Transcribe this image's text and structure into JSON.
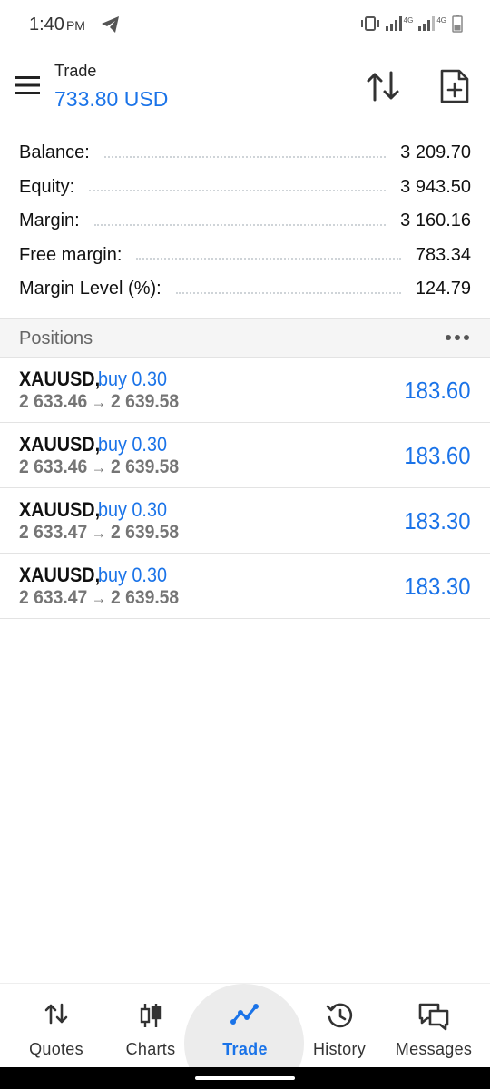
{
  "status_bar": {
    "time": "1:40",
    "ampm": "PM",
    "network_1": "4G",
    "network_2": "4G"
  },
  "header": {
    "title": "Trade",
    "value": "733.80 USD",
    "icons": [
      "menu-icon",
      "sort-icon",
      "new-order-icon"
    ]
  },
  "account": [
    {
      "label": "Balance:",
      "value": "3 209.70"
    },
    {
      "label": "Equity:",
      "value": "3 943.50"
    },
    {
      "label": "Margin:",
      "value": "3 160.16"
    },
    {
      "label": "Free margin:",
      "value": "783.34"
    },
    {
      "label": "Margin Level (%):",
      "value": "124.79"
    }
  ],
  "positions": {
    "title": "Positions",
    "items": [
      {
        "symbol": "XAUUSD,",
        "side": "buy 0.30",
        "open_price": "2 633.46",
        "arrow": "→",
        "current_price": "2 639.58",
        "profit": "183.60"
      },
      {
        "symbol": "XAUUSD,",
        "side": "buy 0.30",
        "open_price": "2 633.46",
        "arrow": "→",
        "current_price": "2 639.58",
        "profit": "183.60"
      },
      {
        "symbol": "XAUUSD,",
        "side": "buy 0.30",
        "open_price": "2 633.47",
        "arrow": "→",
        "current_price": "2 639.58",
        "profit": "183.30"
      },
      {
        "symbol": "XAUUSD,",
        "side": "buy 0.30",
        "open_price": "2 633.47",
        "arrow": "→",
        "current_price": "2 639.58",
        "profit": "183.30"
      }
    ]
  },
  "nav": {
    "quotes": "Quotes",
    "charts": "Charts",
    "trade": "Trade",
    "history": "History",
    "messages": "Messages",
    "active": "trade"
  },
  "colors": {
    "accent": "#1a73e8",
    "muted_price": "#757575",
    "section_bg": "#f5f5f5"
  }
}
